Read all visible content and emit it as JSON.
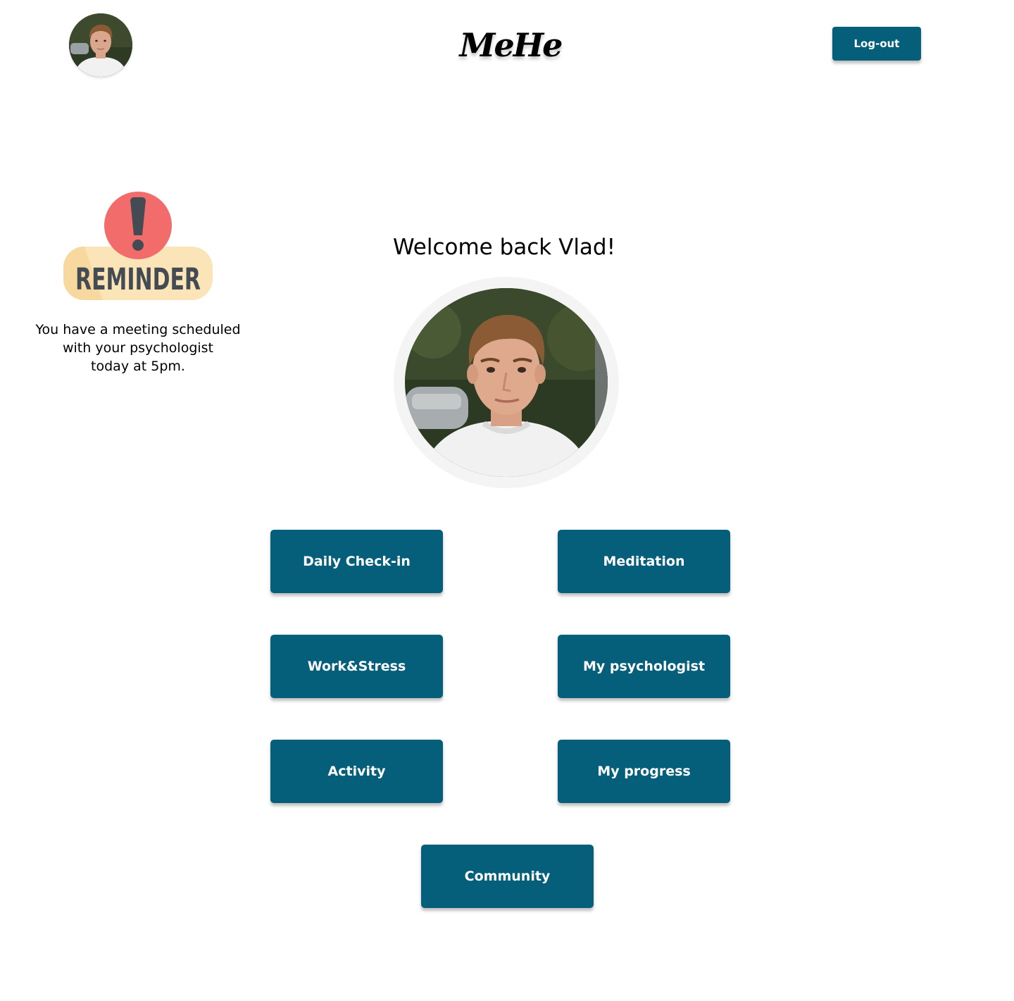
{
  "header": {
    "brand": "MeHe",
    "logout_label": "Log-out"
  },
  "reminder": {
    "badge_text": "REMINDER",
    "line1": "You have a meeting scheduled",
    "line2": "with your psychologist",
    "line3": "today at 5pm."
  },
  "welcome": {
    "title": "Welcome back Vlad!"
  },
  "menu": {
    "daily_checkin": "Daily Check-in",
    "meditation": "Meditation",
    "work_stress": "Work&Stress",
    "my_psychologist": "My psychologist",
    "activity": "Activity",
    "my_progress": "My progress",
    "community": "Community"
  },
  "colors": {
    "primary": "#055e7a",
    "reminder_alert": "#f26c6c",
    "reminder_badge": "#fbe5b8",
    "reminder_text": "#454b53"
  },
  "icons": {
    "profile": "profile-photo",
    "reminder": "exclamation-icon"
  }
}
